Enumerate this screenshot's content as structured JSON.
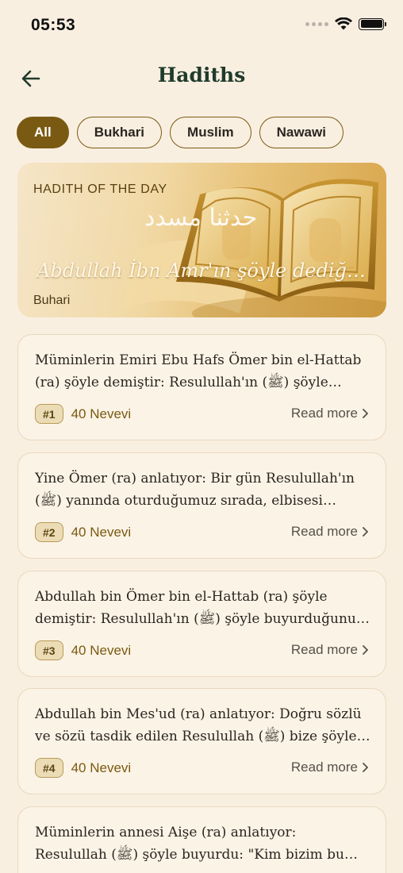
{
  "status": {
    "time": "05:53"
  },
  "header": {
    "title": "Hadiths"
  },
  "filters": [
    {
      "label": "All",
      "active": true
    },
    {
      "label": "Bukhari",
      "active": false
    },
    {
      "label": "Muslim",
      "active": false
    },
    {
      "label": "Nawawi",
      "active": false
    }
  ],
  "hero": {
    "kicker": "HADITH OF THE DAY",
    "arabic": "حدثنا مسدد",
    "title": "Abdullah İbn Amr'ın şöyle dediği ...",
    "source": "Buhari"
  },
  "hadiths": [
    {
      "text": "Müminlerin Emiri Ebu Hafs Ömer bin el-Hattab (ra) şöyle demiştir: Resulullah'ın (ﷺ) şöyle buyurduğunu işittim...",
      "badge": "#1",
      "source": "40 Nevevi",
      "action": "Read more"
    },
    {
      "text": "Yine Ömer (ra) anlatıyor: Bir gün Resulullah'ın (ﷺ) yanında oturduğumuz sırada, elbisesi bembeyaz...",
      "badge": "#2",
      "source": "40 Nevevi",
      "action": "Read more"
    },
    {
      "text": "Abdullah bin Ömer bin el-Hattab (ra) şöyle demiştir: Resulullah'ın (ﷺ) şöyle buyurduğunu işittim...",
      "badge": "#3",
      "source": "40 Nevevi",
      "action": "Read more"
    },
    {
      "text": "Abdullah bin Mes'ud (ra) anlatıyor: Doğru sözlü ve sözü tasdik edilen Resulullah (ﷺ) bize şöyle anlattı...",
      "badge": "#4",
      "source": "40 Nevevi",
      "action": "Read more"
    },
    {
      "text": "Müminlerin annesi Aişe (ra) anlatıyor: Resulullah (ﷺ) şöyle buyurdu: \"Kim bizim bu işimizde (dinimizde)...",
      "badge": "",
      "source": "",
      "action": ""
    }
  ],
  "colors": {
    "accent": "#7a5a12",
    "background": "#f9efe1",
    "title": "#1f3b2b"
  }
}
